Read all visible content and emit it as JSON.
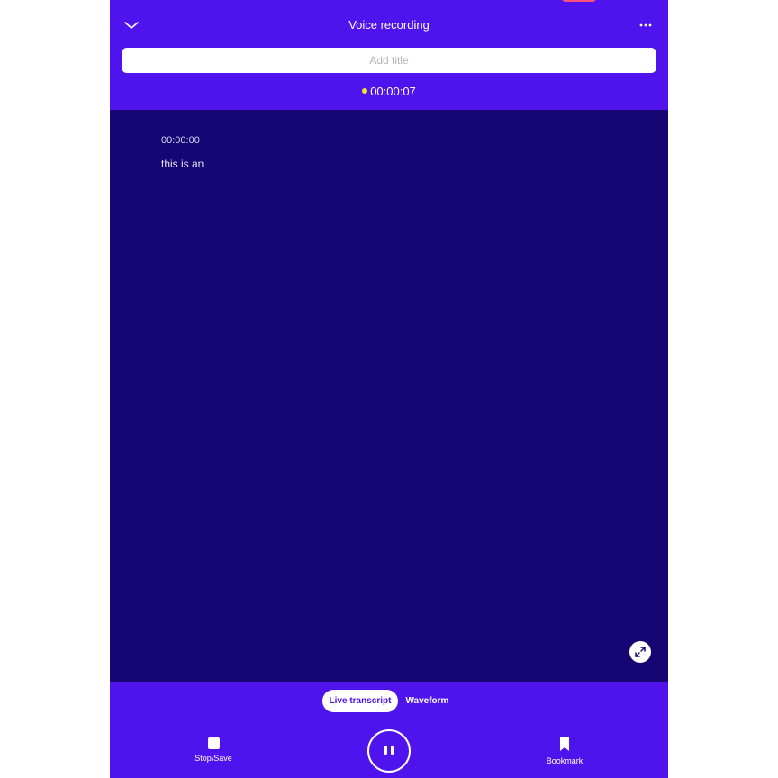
{
  "header": {
    "title": "Voice recording",
    "back_icon": "chevron-down-icon",
    "more_icon": "more-horizontal-icon",
    "title_placeholder": "Add title",
    "recording_indicator_color": "#f3e52a",
    "elapsed_time": "00:00:07"
  },
  "transcript": {
    "entries": [
      {
        "time": "00:00:00",
        "text": "this is an"
      }
    ],
    "expand_icon": "expand-icon"
  },
  "view_tabs": [
    {
      "label": "Live transcript",
      "selected": true
    },
    {
      "label": "Waveform",
      "selected": false
    }
  ],
  "controls": {
    "stop_label": "Stop/Save",
    "stop_icon": "stop-icon",
    "pause_icon": "pause-icon",
    "bookmark_label": "Bookmark",
    "bookmark_icon": "bookmark-icon"
  },
  "colors": {
    "accent": "#4f14ee",
    "panel_background": "#150674",
    "notification_pill": "#ff4f7b"
  }
}
